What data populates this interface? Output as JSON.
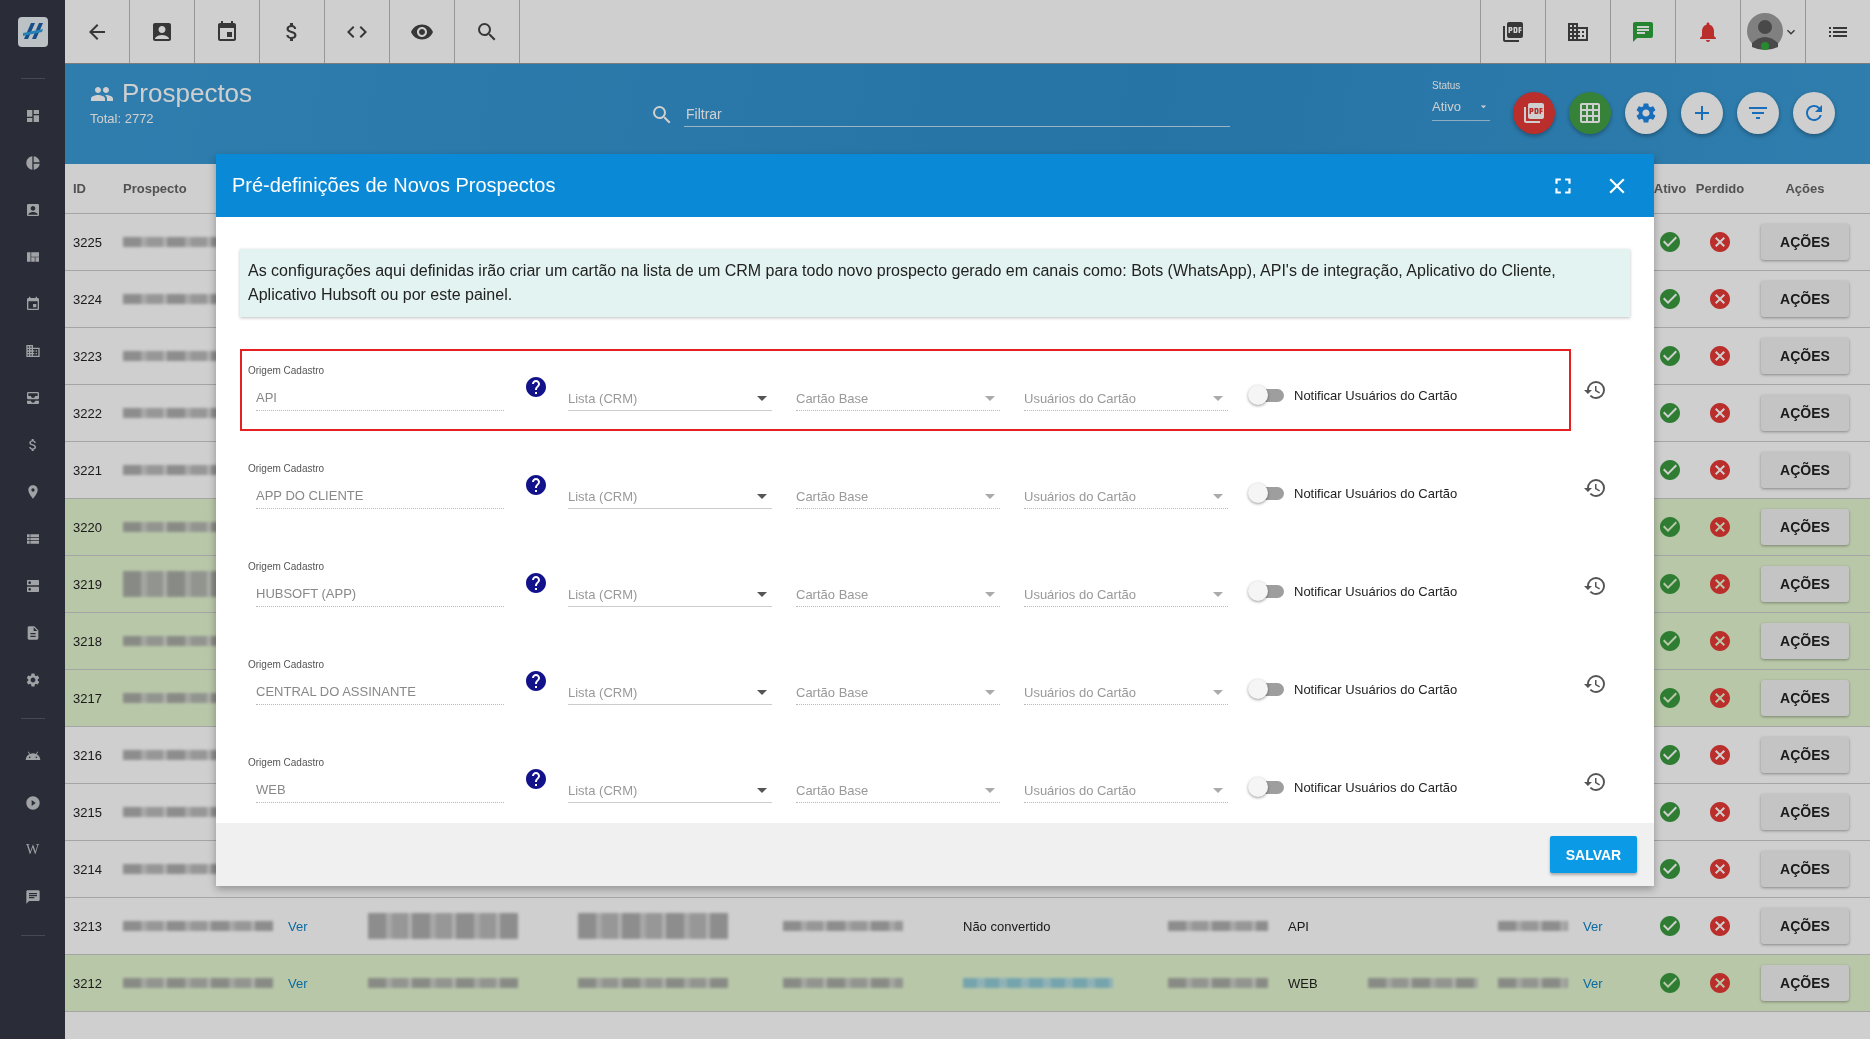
{
  "page": {
    "title": "Prospectos",
    "total": "Total: 2772",
    "search": {
      "placeholder": "Filtrar"
    },
    "status": {
      "label": "Status",
      "value": "Ativo"
    }
  },
  "sidebar": {
    "wiki_glyph": "W"
  },
  "table": {
    "columns": [
      "ID",
      "Prospecto",
      "Ativo",
      "Perdido",
      "Ações"
    ],
    "rows": [
      {
        "id": "3225",
        "highlighted": false,
        "cells": [
          {
            "kind": "blurred"
          }
        ],
        "acoes": "AÇÕES"
      },
      {
        "id": "3224",
        "highlighted": false,
        "cells": [
          {
            "kind": "blurred"
          }
        ],
        "acoes": "AÇÕES"
      },
      {
        "id": "3223",
        "highlighted": false,
        "cells": [
          {
            "kind": "blurred"
          }
        ],
        "acoes": "AÇÕES"
      },
      {
        "id": "3222",
        "highlighted": false,
        "cells": [
          {
            "kind": "blurred"
          }
        ],
        "acoes": "AÇÕES"
      },
      {
        "id": "3221",
        "highlighted": false,
        "cells": [
          {
            "kind": "blurred"
          }
        ],
        "acoes": "AÇÕES"
      },
      {
        "id": "3220",
        "highlighted": true,
        "cells": [
          {
            "kind": "blurred"
          }
        ],
        "acoes": "AÇÕES"
      },
      {
        "id": "3219",
        "highlighted": true,
        "cells": [
          {
            "kind": "blurred2"
          }
        ],
        "acoes": "AÇÕES"
      },
      {
        "id": "3218",
        "highlighted": true,
        "cells": [
          {
            "kind": "blurred"
          }
        ],
        "acoes": "AÇÕES"
      },
      {
        "id": "3217",
        "highlighted": true,
        "cells": [
          {
            "kind": "blurred"
          }
        ],
        "acoes": "AÇÕES"
      },
      {
        "id": "3216",
        "highlighted": false,
        "cells": [
          {
            "kind": "blurred"
          }
        ],
        "acoes": "AÇÕES"
      },
      {
        "id": "3215",
        "highlighted": false,
        "cells": [
          {
            "kind": "blurred"
          }
        ],
        "acoes": "AÇÕES"
      },
      {
        "id": "3214",
        "highlighted": false,
        "cells": [
          {
            "kind": "blurred"
          }
        ],
        "acoes": "AÇÕES"
      },
      {
        "id": "3213",
        "highlighted": false,
        "cells": [
          {
            "kind": "blurred"
          },
          {
            "kind": "link",
            "text": "Ver"
          },
          {
            "kind": "blurred2"
          },
          {
            "kind": "blurred2"
          },
          {
            "kind": "blurred"
          },
          {
            "kind": "text",
            "text": "Não convertido"
          },
          {
            "kind": "blurred"
          },
          {
            "kind": "text",
            "text": "API"
          },
          {
            "kind": "none"
          },
          {
            "kind": "blurred"
          },
          {
            "kind": "link",
            "text": "Ver"
          }
        ],
        "acoes": "AÇÕES"
      },
      {
        "id": "3212",
        "highlighted": true,
        "cells": [
          {
            "kind": "blurred"
          },
          {
            "kind": "link",
            "text": "Ver"
          },
          {
            "kind": "blurred"
          },
          {
            "kind": "blurred"
          },
          {
            "kind": "blurred"
          },
          {
            "kind": "blurred_link"
          },
          {
            "kind": "blurred"
          },
          {
            "kind": "text",
            "text": "WEB"
          },
          {
            "kind": "blurred"
          },
          {
            "kind": "blurred"
          },
          {
            "kind": "link",
            "text": "Ver"
          }
        ],
        "acoes": "AÇÕES"
      }
    ]
  },
  "modal": {
    "title": "Pré-definições de Novos Prospectos",
    "info": "As configurações aqui definidas irão criar um cartão na lista de um CRM para todo novo prospecto gerado em canais como: Bots (WhatsApp), API's de integração, Aplicativo do Cliente, Aplicativo Hubsoft ou por este painel.",
    "rows": [
      {
        "highlighted": true,
        "label": "Origem Cadastro",
        "value": "API",
        "lista": "Lista (CRM)",
        "cartao": "Cartão Base",
        "usuarios": "Usuários do Cartão",
        "notify": {
          "label": "Notificar Usuários do Cartão",
          "on": false
        }
      },
      {
        "highlighted": false,
        "label": "Origem Cadastro",
        "value": "APP DO CLIENTE",
        "lista": "Lista (CRM)",
        "cartao": "Cartão Base",
        "usuarios": "Usuários do Cartão",
        "notify": {
          "label": "Notificar Usuários do Cartão",
          "on": false
        }
      },
      {
        "highlighted": false,
        "label": "Origem Cadastro",
        "value": "HUBSOFT (APP)",
        "lista": "Lista (CRM)",
        "cartao": "Cartão Base",
        "usuarios": "Usuários do Cartão",
        "notify": {
          "label": "Notificar Usuários do Cartão",
          "on": false
        }
      },
      {
        "highlighted": false,
        "label": "Origem Cadastro",
        "value": "CENTRAL DO ASSINANTE",
        "lista": "Lista (CRM)",
        "cartao": "Cartão Base",
        "usuarios": "Usuários do Cartão",
        "notify": {
          "label": "Notificar Usuários do Cartão",
          "on": false
        }
      },
      {
        "highlighted": false,
        "label": "Origem Cadastro",
        "value": "WEB",
        "lista": "Lista (CRM)",
        "cartao": "Cartão Base",
        "usuarios": "Usuários do Cartão",
        "notify": {
          "label": "Notificar Usuários do Cartão",
          "on": false
        }
      }
    ],
    "save": "SALVAR"
  }
}
